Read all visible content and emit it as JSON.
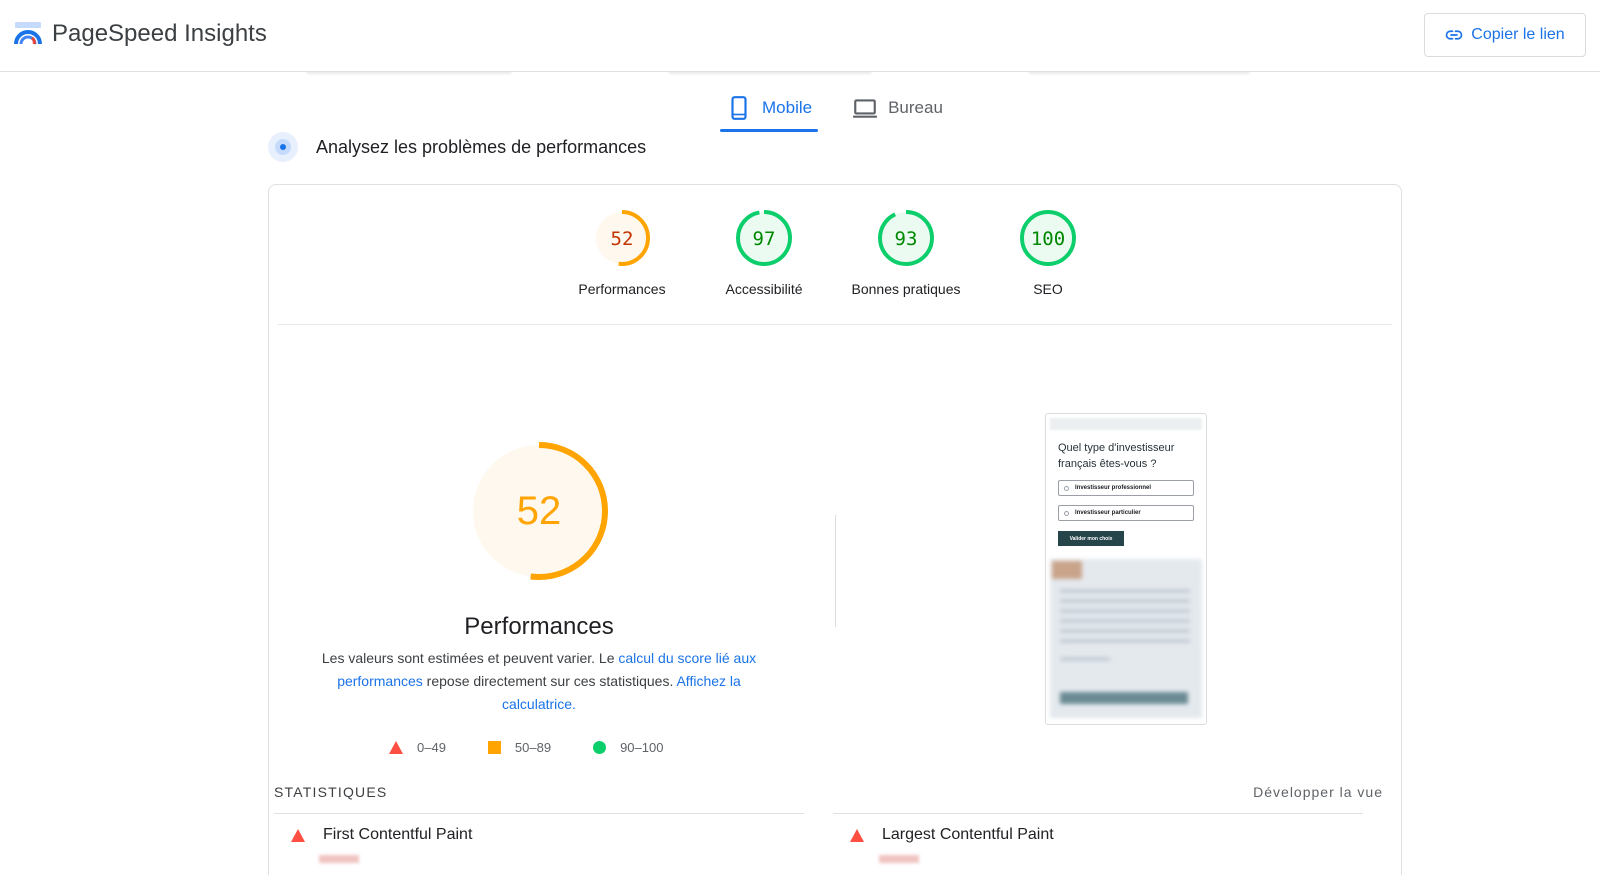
{
  "header": {
    "app_title": "PageSpeed Insights",
    "copy_link_label": "Copier le lien"
  },
  "tabs": [
    {
      "label": "Mobile",
      "active": true,
      "icon": "smartphone-icon"
    },
    {
      "label": "Bureau",
      "active": false,
      "icon": "laptop-icon"
    }
  ],
  "section": {
    "title": "Analysez les problèmes de performances"
  },
  "scores": [
    {
      "value": "52",
      "label": "Performances",
      "status": "average"
    },
    {
      "value": "97",
      "label": "Accessibilité",
      "status": "pass"
    },
    {
      "value": "93",
      "label": "Bonnes pratiques",
      "status": "pass"
    },
    {
      "value": "100",
      "label": "SEO",
      "status": "pass"
    }
  ],
  "performance": {
    "score": "52",
    "title": "Performances",
    "desc_text_1": "Les valeurs sont estimées et peuvent varier. Le ",
    "desc_link_1": "calcul du score lié aux performances",
    "desc_text_2": " repose directement sur ces statistiques. ",
    "desc_link_2": "Affichez la calculatrice."
  },
  "legend": [
    {
      "range": "0–49",
      "shape": "triangle",
      "color": "#ff4e42"
    },
    {
      "range": "50–89",
      "shape": "square",
      "color": "#ffa400"
    },
    {
      "range": "90–100",
      "shape": "circle",
      "color": "#0cce6b"
    }
  ],
  "screenshot": {
    "question": "Quel type d'investisseur français êtes-vous ?",
    "option_1": "Investisseur professionnel",
    "option_2": "Investisseur particulier",
    "button": "Valider mon choix"
  },
  "statistics": {
    "title": "STATISTIQUES",
    "expand_label": "Développer la vue",
    "metrics": [
      {
        "name": "First Contentful Paint",
        "status": "fail"
      },
      {
        "name": "Largest Contentful Paint",
        "status": "fail"
      }
    ]
  },
  "colors": {
    "accent": "#1a73e8",
    "fail": "#ff4e42",
    "average": "#ffa400",
    "pass": "#0cce6b",
    "average_text": "#c33300",
    "pass_text": "#008800"
  }
}
